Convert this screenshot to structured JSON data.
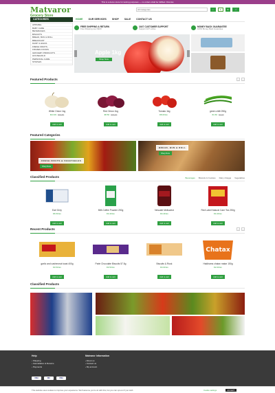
{
  "notice": "This is a demo store for testing purposes — no orders shall be fulfilled. Dismiss",
  "brand": {
    "logo": "Matvaror",
    "tagline": "Grocery Store"
  },
  "search": {
    "category_placeholder": "All Categories"
  },
  "header_icons": [
    "$",
    "♥",
    "🛒"
  ],
  "nav": {
    "categories_label": "CATEGORIES",
    "links": [
      "HOME",
      "OUR SERVICES",
      "SHOP",
      "SALE",
      "CONTACT US"
    ]
  },
  "sidebar": {
    "items": [
      "APPAREL",
      "BABY CARE",
      "BEVERAGES",
      "BISCUITS",
      "BREAD, BUN & ROLL",
      "BREAKFAST",
      "DAIRY & EGGS",
      "FRESH FRUITS",
      "FROZEN FOODS",
      "GROCERY PRODUCTS",
      "HOUSEHOLD",
      "PERSONAL CARE",
      "STAPLES"
    ]
  },
  "services": [
    {
      "title": "FREE SHIPPING & RETURN",
      "sub": "Free Shipping over $100"
    },
    {
      "title": "24X7 CUSTOMER SUPPORT",
      "sub": "Support 24/7 online"
    },
    {
      "title": "MONEY BACK GUARANTEE",
      "sub": "100% Money Back Guarantee"
    }
  ],
  "hero": {
    "title": "Apple 1kg",
    "button": "Shop Now"
  },
  "featured_products": {
    "title": "Featured Products",
    "items": [
      {
        "name": "White Onion 1kg",
        "price": "€24.99",
        "old": "€26.50",
        "btn": "Add to cart"
      },
      {
        "name": "Red Onion 1kg",
        "price": "€8.50",
        "old": "€15.00",
        "btn": "Add to cart"
      },
      {
        "name": "Tomato 1kg",
        "price": "€8.00 Ex",
        "old": "",
        "btn": "Add to cart"
      },
      {
        "name": "green chilli 250g",
        "price": "€1.50",
        "old": "€2.00",
        "btn": "Add to cart"
      }
    ]
  },
  "featured_categories": {
    "title": "Featured Categories",
    "left_label": "FRESH FRUITS & VEGETABLES",
    "right_label": "BREAD, BUN & ROLL",
    "button": "Shop Now"
  },
  "classified_products_1": {
    "title": "Classified Products",
    "tabs": [
      "Beverages",
      "Biscuits & Cookies",
      "Dairy & Eggs",
      "Vegetables"
    ],
    "items": [
      {
        "name": "Earl Grey",
        "price": "€6.50 Ex",
        "btn": "Add to cart"
      },
      {
        "name": "MM-Coffee Powder 200g",
        "price": "€3.49 Ex",
        "btn": "Add to cart"
      },
      {
        "name": "Nescafe Mellowest",
        "price": "€3.49 Ex",
        "btn": "Add to cart"
      },
      {
        "name": "Red Label Natural Care Tea 250g",
        "price": "€3.49 Ex",
        "btn": "Add to cart"
      }
    ]
  },
  "recent_products": {
    "title": "Recent Products",
    "items": [
      {
        "name": "garlic and cashewnut toast 400g",
        "price": "€3.50 Ex",
        "btn": "Add to cart"
      },
      {
        "name": "Parle Chocolate Biscuits 57.5g",
        "price": "€3.50 Ex",
        "btn": "Add to cart"
      },
      {
        "name": "Biscuits & Rusk",
        "price": "€3.00 Ex",
        "btn": "Add to cart"
      },
      {
        "name": "Haldirams chatax matar 150g",
        "price": "€2.00 Ex",
        "btn": "Add to cart"
      }
    ]
  },
  "classified_products_2": {
    "title": "Classified Products"
  },
  "footer": {
    "help_title": "Help",
    "help_items": [
      "Shipping",
      "Cancellation & Returns",
      "Payments"
    ],
    "info_title": "Matvaror Information",
    "info_items": [
      "About us",
      "Contact us",
      "My account"
    ],
    "payments": [
      "VISA",
      "MC",
      "VISA"
    ]
  },
  "cookie": {
    "text": "This website uses cookies to improve your experience. We'll assume you're ok with this, but you can opt-out if you wish.",
    "settings": "Cookie settings",
    "accept": "ACCEPT"
  },
  "colors": {
    "brand_green": "#2f9f40",
    "notice_purple": "#9b3e8b",
    "footer_bg": "#3a3a3a"
  }
}
